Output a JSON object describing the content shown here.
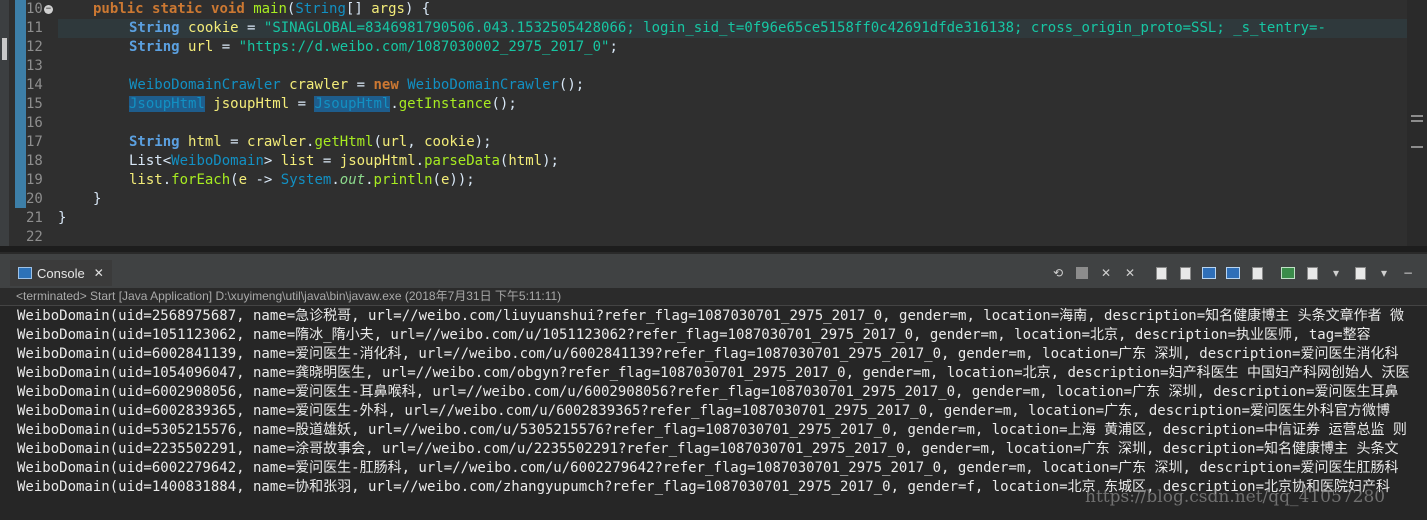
{
  "editor": {
    "line_numbers": [
      "10",
      "11",
      "12",
      "13",
      "14",
      "15",
      "16",
      "17",
      "18",
      "19",
      "20",
      "21",
      "22"
    ],
    "code": {
      "l10": {
        "a": "public",
        "b": "static",
        "c": "void",
        "d": "main",
        "e": "(",
        "f": "String",
        "g": "[] ",
        "h": "args",
        "i": ") {"
      },
      "l11": {
        "a": "String",
        "b": "cookie",
        "c": " = ",
        "d": "\"SINAGLOBAL=8346981790506.043.1532505428066; login_sid_t=0f96e65ce5158ff0c42691dfde316138; cross_origin_proto=SSL; _s_tentry=-"
      },
      "l12": {
        "a": "String",
        "b": "url",
        "c": " = ",
        "d": "\"https://d.weibo.com/1087030002_2975_2017_0\"",
        "e": ";"
      },
      "l14": {
        "a": "WeiboDomainCrawler",
        "b": "crawler",
        "c": " = ",
        "d": "new",
        "e": "WeiboDomainCrawler",
        "f": "();"
      },
      "l15": {
        "a": "JsoupHtml",
        "b": "jsoupHtml",
        "c": " = ",
        "d": "JsoupHtml",
        "e": ".",
        "f": "getInstance",
        "g": "();"
      },
      "l17": {
        "a": "String",
        "b": "html",
        "c": " = ",
        "d": "crawler",
        "e": ".",
        "f": "getHtml",
        "g": "(",
        "h": "url",
        "i": ", ",
        "j": "cookie",
        "k": ");"
      },
      "l18": {
        "a": "List<",
        "b": "WeiboDomain",
        "c": ">",
        "d": "list",
        "e": " = ",
        "f": "jsoupHtml",
        "g": ".",
        "h": "parseData",
        "i": "(",
        "j": "html",
        "k": ");"
      },
      "l19": {
        "a": "list",
        "b": ".",
        "c": "forEach",
        "d": "(",
        "e": "e",
        "f": " -> ",
        "g": "System",
        "h": ".",
        "i": "out",
        "j": ".",
        "k": "println",
        "l": "(",
        "m": "e",
        "n": "));"
      },
      "l20": "}",
      "l21": "}"
    }
  },
  "console": {
    "tab_label": "Console",
    "close_glyph": "✕",
    "status": "<terminated> Start [Java Application] D:\\xuyimeng\\util\\java\\bin\\javaw.exe (2018年7月31日 下午5:11:11)",
    "lines": [
      "WeiboDomain(uid=2568975687, name=急诊税哥, url=//weibo.com/liuyuanshui?refer_flag=1087030701_2975_2017_0, gender=m, location=海南, description=知名健康博主 头条文章作者 微",
      "WeiboDomain(uid=1051123062, name=隋冰_隋小夫, url=//weibo.com/u/1051123062?refer_flag=1087030701_2975_2017_0, gender=m, location=北京, description=执业医师, tag=整容",
      "WeiboDomain(uid=6002841139, name=爱问医生-消化科, url=//weibo.com/u/6002841139?refer_flag=1087030701_2975_2017_0, gender=m, location=广东 深圳, description=爱问医生消化科",
      "WeiboDomain(uid=1054096047, name=龚晓明医生, url=//weibo.com/obgyn?refer_flag=1087030701_2975_2017_0, gender=m, location=北京, description=妇产科医生 中国妇产科网创始人 沃医",
      "WeiboDomain(uid=6002908056, name=爱问医生-耳鼻喉科, url=//weibo.com/u/6002908056?refer_flag=1087030701_2975_2017_0, gender=m, location=广东 深圳, description=爱问医生耳鼻",
      "WeiboDomain(uid=6002839365, name=爱问医生-外科, url=//weibo.com/u/6002839365?refer_flag=1087030701_2975_2017_0, gender=m, location=广东, description=爱问医生外科官方微博",
      "WeiboDomain(uid=5305215576, name=股道雄妖, url=//weibo.com/u/5305215576?refer_flag=1087030701_2975_2017_0, gender=m, location=上海 黄浦区, description=中信证券 运营总监 则",
      "WeiboDomain(uid=2235502291, name=涂哥故事会, url=//weibo.com/u/2235502291?refer_flag=1087030701_2975_2017_0, gender=m, location=广东 深圳, description=知名健康博主 头条文",
      "WeiboDomain(uid=6002279642, name=爱问医生-肛肠科, url=//weibo.com/u/6002279642?refer_flag=1087030701_2975_2017_0, gender=m, location=广东 深圳, description=爱问医生肛肠科",
      "WeiboDomain(uid=1400831884, name=协和张羽, url=//weibo.com/zhangyupumch?refer_flag=1087030701_2975_2017_0, gender=f, location=北京 东城区, description=北京协和医院妇产科"
    ]
  },
  "watermark": "https://blog.csdn.net/qq_41057280",
  "colors": {
    "keyword": "#cc7832",
    "type": "#1290c3",
    "string": "#17c6a3",
    "variable": "#f3ec79",
    "method": "#a7ec21"
  }
}
